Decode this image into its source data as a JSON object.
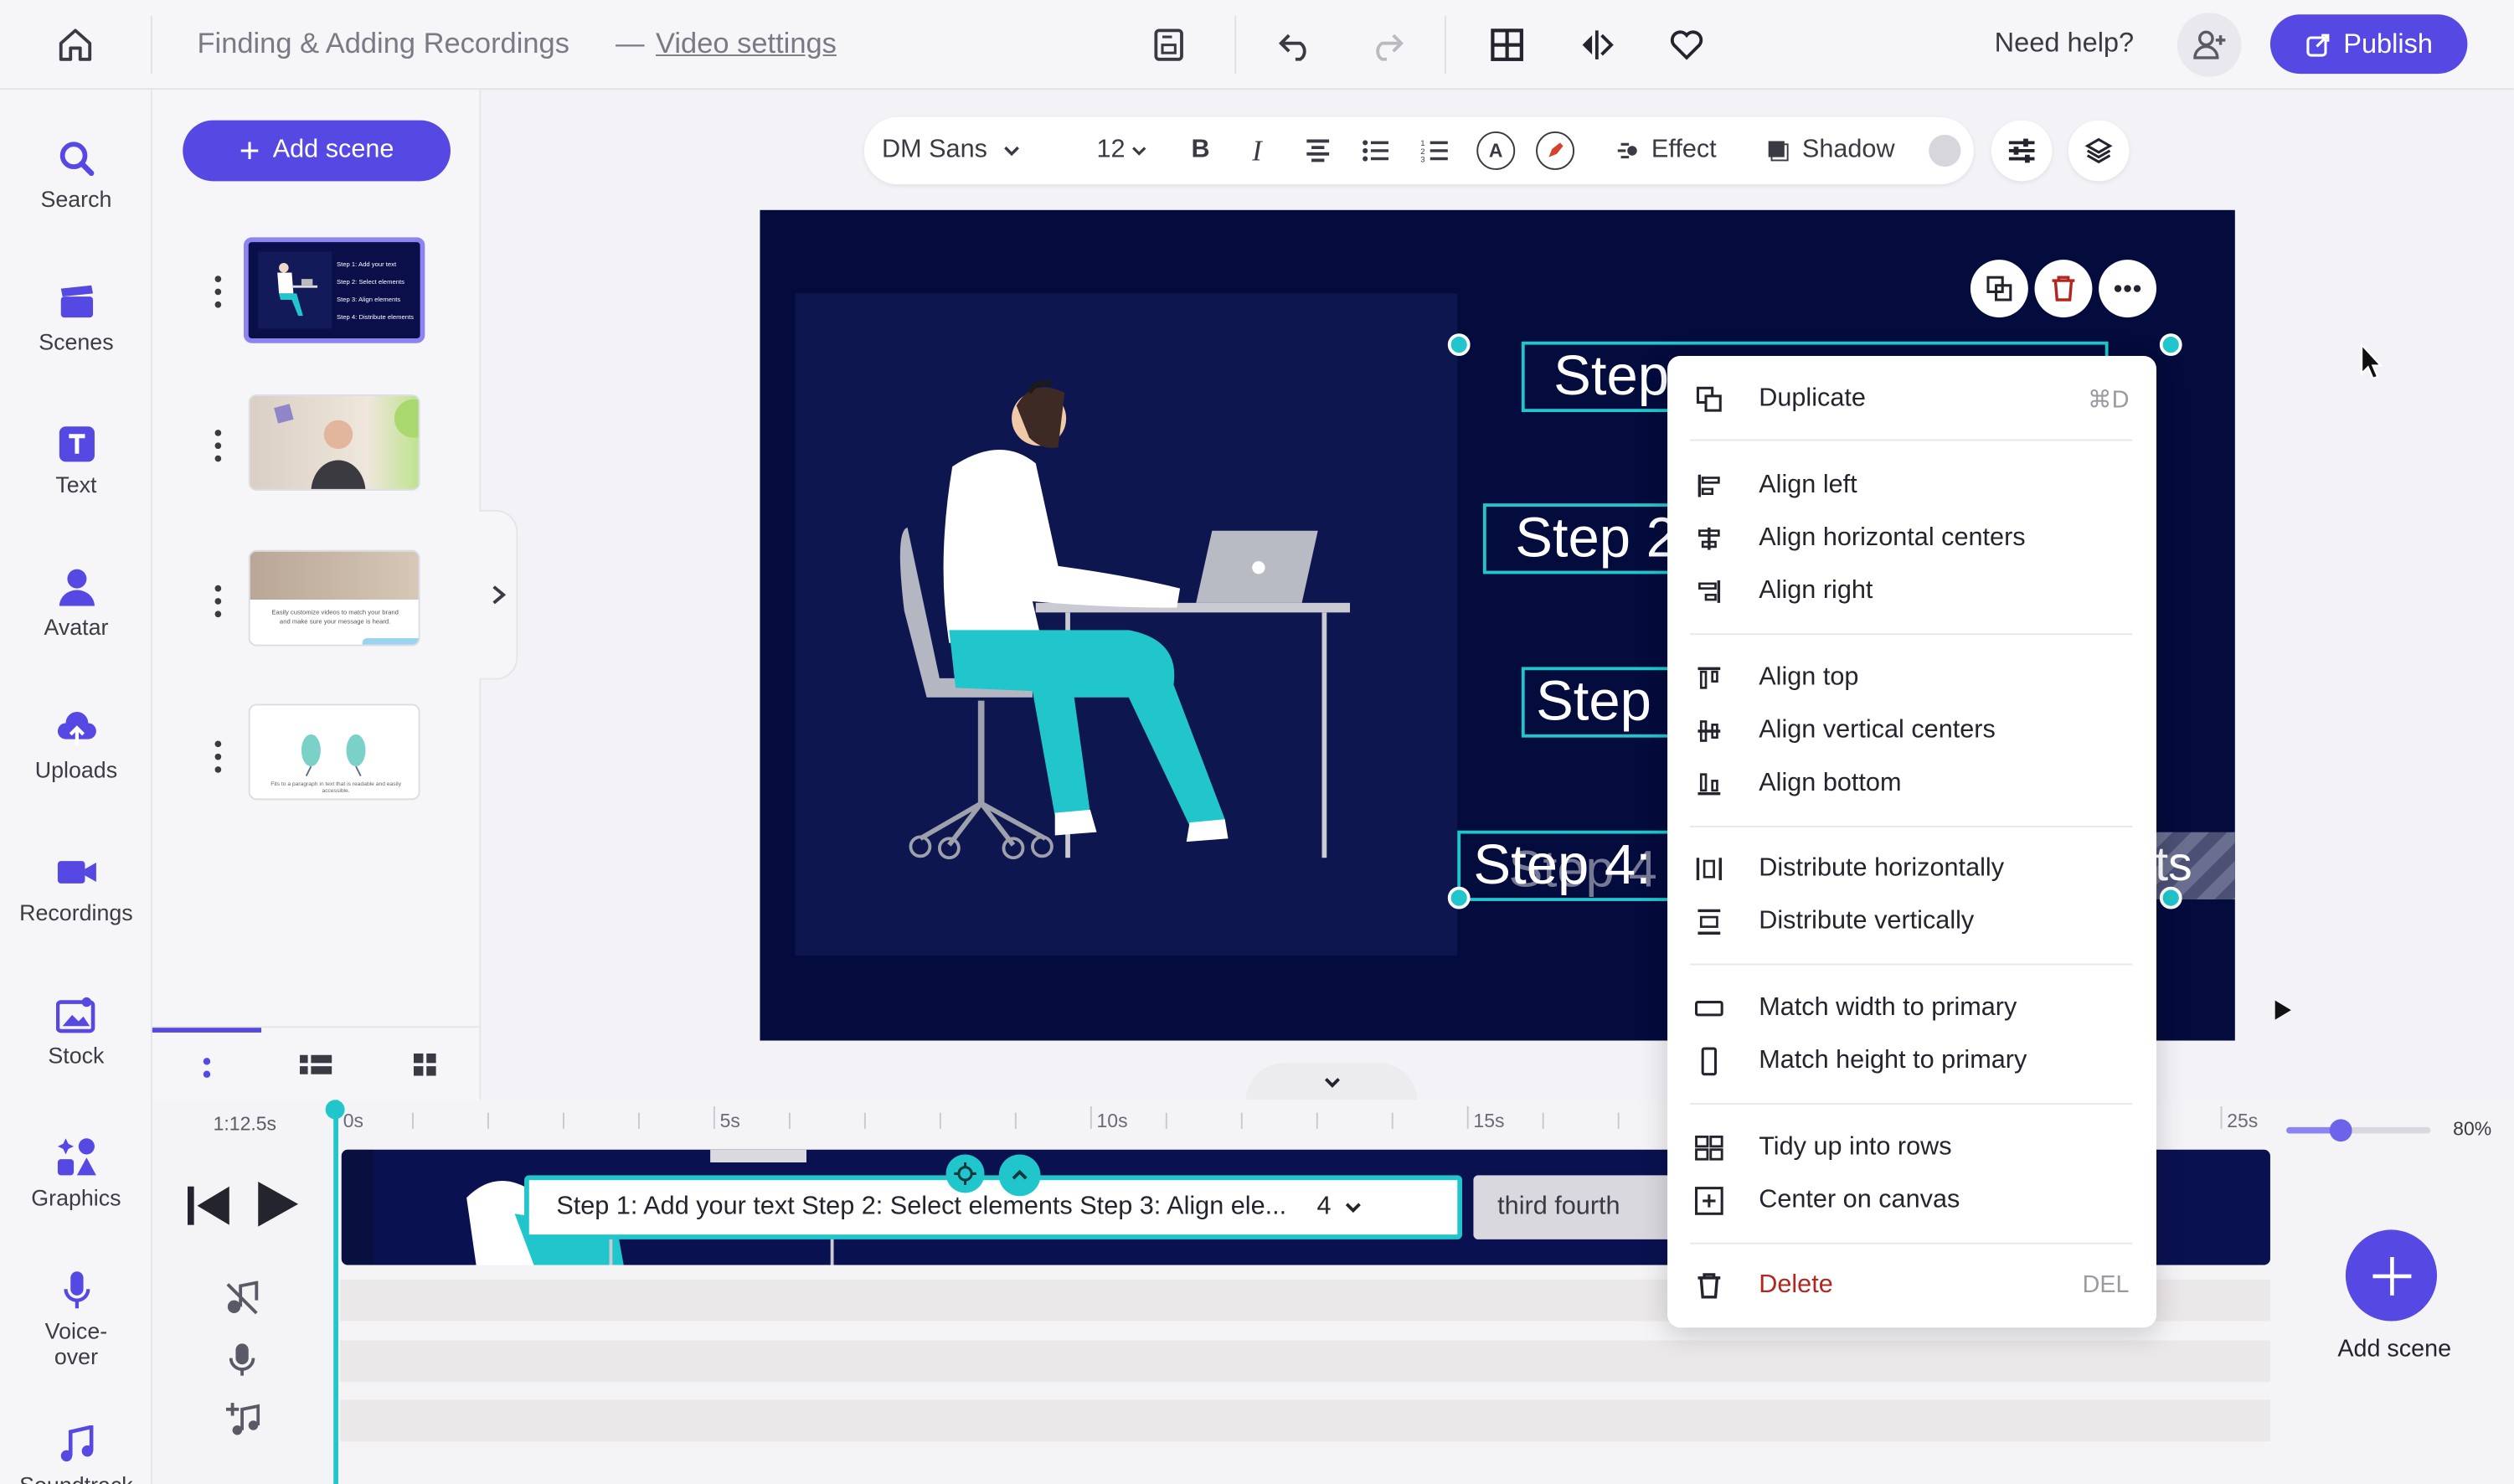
{
  "app": {
    "project_title": "Finding & Adding Recordings",
    "title_dash": "—",
    "video_settings_link": "Video settings",
    "need_help": "Need help?",
    "publish_label": "Publish"
  },
  "rail": {
    "items": [
      {
        "label": "Search",
        "icon": "search-icon"
      },
      {
        "label": "Scenes",
        "icon": "clapperboard-icon"
      },
      {
        "label": "Text",
        "icon": "text-icon"
      },
      {
        "label": "Avatar",
        "icon": "avatar-icon"
      },
      {
        "label": "Uploads",
        "icon": "upload-cloud-icon"
      },
      {
        "label": "Recordings",
        "icon": "video-camera-icon"
      },
      {
        "label": "Stock",
        "icon": "image-icon"
      },
      {
        "label": "Graphics",
        "icon": "shapes-icon"
      },
      {
        "label": "Voice-\nover",
        "label_line1": "Voice-",
        "label_line2": "over",
        "icon": "microphone-icon"
      },
      {
        "label": "Soundtrack",
        "icon": "music-note-icon"
      }
    ]
  },
  "scenes_panel": {
    "add_scene_label": "Add scene",
    "thumbs": [
      {
        "lines": [
          "Step 1: Add your text",
          "Step 2: Select elements",
          "Step 3: Align elements",
          "Step 4: Distribute elements"
        ]
      },
      {
        "caption": ""
      },
      {
        "caption": "Easily customize videos to match your brand and make sure your message is heard."
      },
      {
        "caption": "Fits to a paragraph in text that is readable and easily accessible."
      }
    ]
  },
  "format_toolbar": {
    "font": "DM Sans",
    "size": "12",
    "bold": "B",
    "italic": "I",
    "text_color_letter": "A",
    "effect_label": "Effect",
    "shadow_label": "Shadow"
  },
  "canvas": {
    "steps": [
      "Step",
      "Step 2",
      "Step",
      "Step 4:"
    ],
    "step4_overlay": "Step 4",
    "step4_tail": "ts"
  },
  "context_menu": {
    "items": [
      {
        "label": "Duplicate",
        "shortcut": "⌘D",
        "icon": "duplicate-icon"
      },
      {
        "label": "Align left",
        "icon": "align-left-icon"
      },
      {
        "label": "Align horizontal centers",
        "icon": "align-h-center-icon"
      },
      {
        "label": "Align right",
        "icon": "align-right-icon"
      },
      {
        "label": "Align top",
        "icon": "align-top-icon"
      },
      {
        "label": "Align vertical centers",
        "icon": "align-v-center-icon"
      },
      {
        "label": "Align bottom",
        "icon": "align-bottom-icon"
      },
      {
        "label": "Distribute horizontally",
        "icon": "distribute-h-icon"
      },
      {
        "label": "Distribute vertically",
        "icon": "distribute-v-icon"
      },
      {
        "label": "Match width to primary",
        "icon": "match-width-icon"
      },
      {
        "label": "Match height to primary",
        "icon": "match-height-icon"
      },
      {
        "label": "Tidy up into rows",
        "icon": "grid-icon"
      },
      {
        "label": "Center on canvas",
        "icon": "center-canvas-icon"
      },
      {
        "label": "Delete",
        "shortcut": "DEL",
        "icon": "trash-icon",
        "color": "#b3261e"
      }
    ]
  },
  "timeline": {
    "duration": "1:12.5s",
    "ticks": [
      "0s",
      "5s",
      "10s",
      "15s",
      "25s"
    ],
    "clip_text": "Step 1: Add your text Step 2: Select elements Step 3: Align ele...",
    "clip_count": "4",
    "clip2_text": "third fourth",
    "zoom": "80%",
    "zoom_fraction": 0.8,
    "add_scene_label": "Add scene"
  },
  "colors": {
    "accent": "#5649e3",
    "selection": "#20c6cc",
    "canvas_bg": "#040b3d",
    "danger": "#b3261e"
  }
}
